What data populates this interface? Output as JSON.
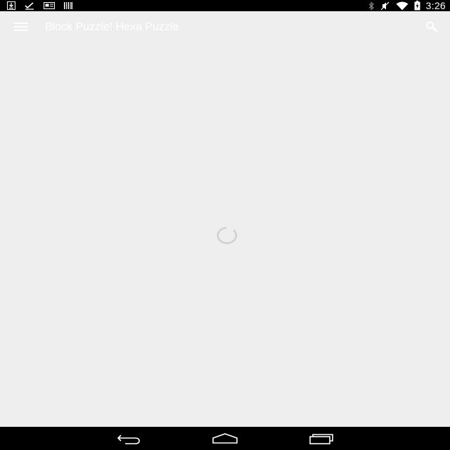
{
  "status_bar": {
    "left_icons": [
      "download-icon",
      "checkmark-icon",
      "news-icon",
      "barcode-icon"
    ],
    "right_icons": [
      "bluetooth-icon",
      "mute-icon",
      "wifi-icon",
      "battery-charging-icon"
    ],
    "time": "3:26"
  },
  "app_bar": {
    "menu_icon": "hamburger-menu-icon",
    "title": "Block Puzzle! Hexa Puzzle",
    "search_icon": "search-icon"
  },
  "content": {
    "state": "loading",
    "indicator": "loading-spinner"
  },
  "nav_bar": {
    "buttons": [
      "back-icon",
      "home-icon",
      "recents-icon"
    ]
  },
  "colors": {
    "status_bar_bg": "#000000",
    "app_background": "#eeeeee",
    "title_text": "#ffffff",
    "nav_bar_bg": "#000000",
    "spinner": "#d0d0d0"
  }
}
